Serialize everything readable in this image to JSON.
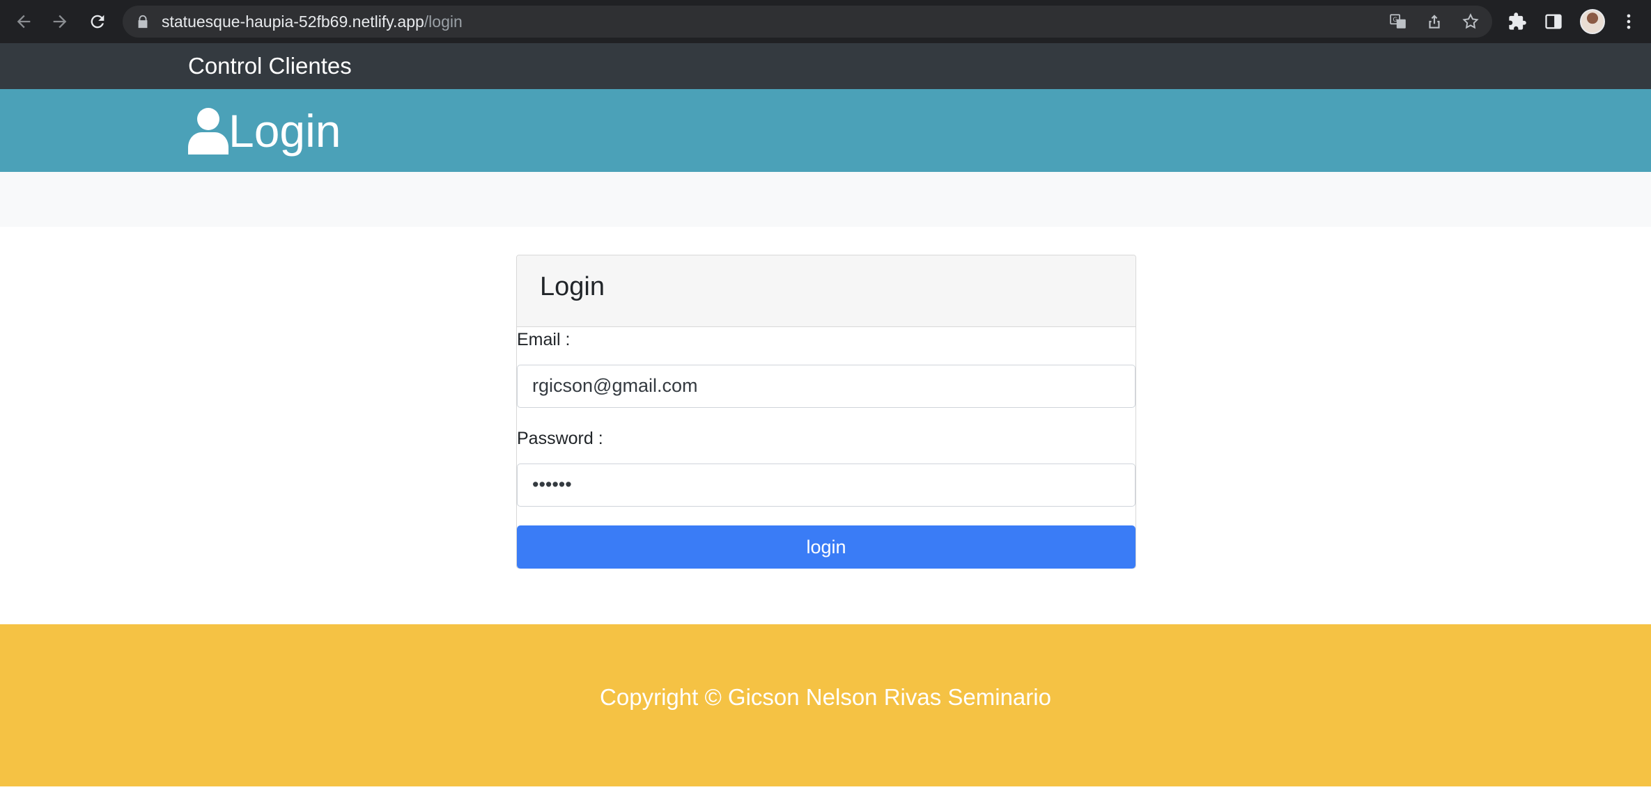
{
  "browser": {
    "url_host": "statuesque-haupia-52fb69.netlify.app",
    "url_path": "/login",
    "icons": [
      "back-icon",
      "forward-icon",
      "reload-icon",
      "lock-icon",
      "translate-icon",
      "share-icon",
      "bookmark-star-icon",
      "extensions-icon",
      "side-panel-icon",
      "profile-avatar",
      "menu-kebab-icon"
    ]
  },
  "navbar": {
    "brand": "Control Clientes"
  },
  "header": {
    "title": "Login",
    "icon": "user-icon"
  },
  "card": {
    "title": "Login",
    "email_label": "Email :",
    "email_value": "rgicson@gmail.com",
    "password_label": "Password :",
    "password_value": "••••••",
    "submit_label": "login"
  },
  "footer": {
    "text": "Copyright © Gicson Nelson Rivas Seminario"
  },
  "colors": {
    "navbar": "#343a40",
    "header": "#4ba1b8",
    "primary_button": "#3a7cf6",
    "footer": "#f5c244"
  }
}
